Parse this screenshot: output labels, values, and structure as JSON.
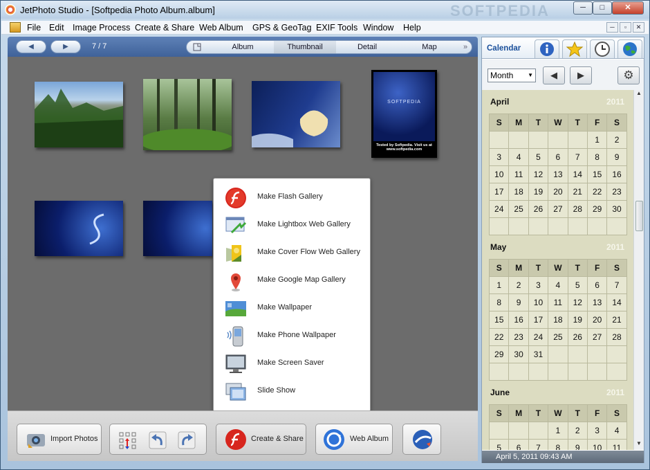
{
  "window": {
    "title": "JetPhoto Studio - [Softpedia Photo Album.album]",
    "watermark": "SOFTPEDIA",
    "min_label": "─",
    "max_label": "□",
    "close_label": "✕"
  },
  "menu": {
    "items": [
      "File",
      "Edit",
      "Image Process",
      "Create & Share",
      "Web Album",
      "GPS & GeoTag",
      "EXIF Tools",
      "Window",
      "Help"
    ],
    "mdi": [
      "─",
      "▫",
      "✕"
    ]
  },
  "toolbar": {
    "back_label": "◀",
    "forward_label": "▶",
    "counter": "7 / 7",
    "tabs": [
      "Album",
      "Thumbnail",
      "Detail",
      "Map"
    ],
    "active_tab": "Thumbnail",
    "more_label": "»"
  },
  "thumbnail_text": {
    "tested_line": "Tested by Softpedia. Visit us at",
    "url_line": "www.softpedia.com",
    "softpedia_logo": "SOFTPEDIA"
  },
  "popup_menu": {
    "items": [
      {
        "label": "Make Flash Gallery",
        "icon": "flash-icon"
      },
      {
        "label": "Make Lightbox Web Gallery",
        "icon": "lightbox-icon"
      },
      {
        "label": "Make Cover Flow Web Gallery",
        "icon": "coverflow-icon"
      },
      {
        "label": "Make Google Map Gallery",
        "icon": "map-pin-icon"
      },
      {
        "label": "Make Wallpaper",
        "icon": "wallpaper-icon"
      },
      {
        "label": "Make Phone Wallpaper",
        "icon": "phone-icon"
      },
      {
        "label": "Make Screen Saver",
        "icon": "monitor-icon"
      },
      {
        "label": "Slide Show",
        "icon": "slideshow-icon"
      }
    ]
  },
  "bottom_bar": {
    "import_label": "Import Photos",
    "create_share_label": "Create & Share",
    "web_album_label": "Web Album"
  },
  "right_panel": {
    "calendar_tab": "Calendar",
    "period_select": "Month",
    "prev_label": "◀",
    "next_label": "▶",
    "status": "April 5, 2011 09:43 AM",
    "weekdays": [
      "S",
      "M",
      "T",
      "W",
      "T",
      "F",
      "S"
    ],
    "months": [
      {
        "name": "April",
        "year": "2011",
        "weeks": [
          [
            "",
            "",
            "",
            "",
            "",
            "1",
            "2"
          ],
          [
            "3",
            "4",
            "5",
            "6",
            "7",
            "8",
            "9"
          ],
          [
            "10",
            "11",
            "12",
            "13",
            "14",
            "15",
            "16"
          ],
          [
            "17",
            "18",
            "19",
            "20",
            "21",
            "22",
            "23"
          ],
          [
            "24",
            "25",
            "26",
            "27",
            "28",
            "29",
            "30"
          ],
          [
            "",
            "",
            "",
            "",
            "",
            "",
            ""
          ]
        ]
      },
      {
        "name": "May",
        "year": "2011",
        "weeks": [
          [
            "1",
            "2",
            "3",
            "4",
            "5",
            "6",
            "7"
          ],
          [
            "8",
            "9",
            "10",
            "11",
            "12",
            "13",
            "14"
          ],
          [
            "15",
            "16",
            "17",
            "18",
            "19",
            "20",
            "21"
          ],
          [
            "22",
            "23",
            "24",
            "25",
            "26",
            "27",
            "28"
          ],
          [
            "29",
            "30",
            "31",
            "",
            "",
            "",
            ""
          ],
          [
            "",
            "",
            "",
            "",
            "",
            "",
            ""
          ]
        ]
      },
      {
        "name": "June",
        "year": "2011",
        "weeks": [
          [
            "",
            "",
            "",
            "1",
            "2",
            "3",
            "4"
          ],
          [
            "5",
            "6",
            "7",
            "8",
            "9",
            "10",
            "11"
          ]
        ]
      }
    ]
  },
  "colors": {
    "toolbar_blue": "#4a6ea6",
    "canvas_gray": "#6c6c6c",
    "calendar_bg": "#dcdcc1",
    "calendar_header": "#c9c9ad"
  }
}
